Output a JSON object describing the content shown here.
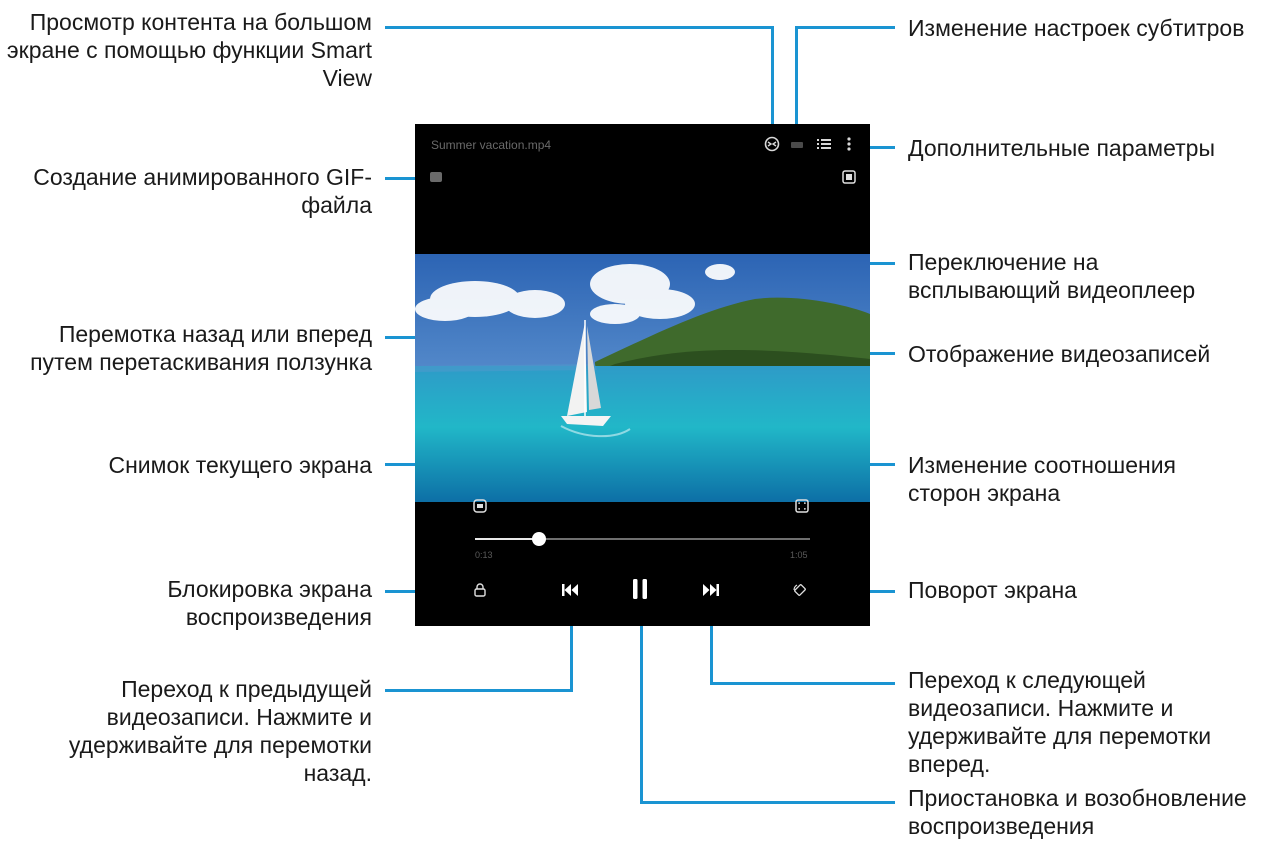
{
  "player": {
    "file_title": "Summer vacation.mp4",
    "current_time": "0:13",
    "total_time": "1:05",
    "progress": 0.19,
    "state": "playing"
  },
  "icons": {
    "smart_view": "smart-view-icon",
    "subtitles": "subtitles-icon",
    "playlist": "playlist-icon",
    "more_options": "more-options-icon",
    "gif": "gif-icon",
    "popup_player": "popup-player-icon",
    "capture": "capture-icon",
    "aspect_ratio": "aspect-ratio-icon",
    "lock": "lock-icon",
    "rotate": "rotate-icon",
    "previous": "previous-icon",
    "pause": "pause-icon",
    "next": "next-icon"
  },
  "callouts": {
    "smart_view": "Просмотр контента на большом экране с помощью функции Smart View",
    "gif": "Создание анимированного GIF-файла",
    "seek": "Перемотка назад или вперед путем перетаскивания ползунка",
    "capture": "Снимок текущего экрана",
    "lock": "Блокировка экрана воспроизведения",
    "previous": "Переход к предыдущей видеозаписи. Нажмите и удерживайте для перемотки назад.",
    "subtitles": "Изменение настроек субтитров",
    "more_options": "Дополнительные параметры",
    "popup_player": "Переключение на всплывающий видеоплеер",
    "playlist": "Отображение видеозаписей",
    "aspect_ratio": "Изменение соотношения сторон экрана",
    "rotate": "Поворот экрана",
    "next": "Переход к следующей видеозаписи. Нажмите и удерживайте для перемотки вперед.",
    "pause": "Приостановка и возобновление воспроизведения"
  },
  "colors": {
    "accent_line": "#1a94d2",
    "player_bg": "#000000",
    "text": "#1a1a1a"
  }
}
